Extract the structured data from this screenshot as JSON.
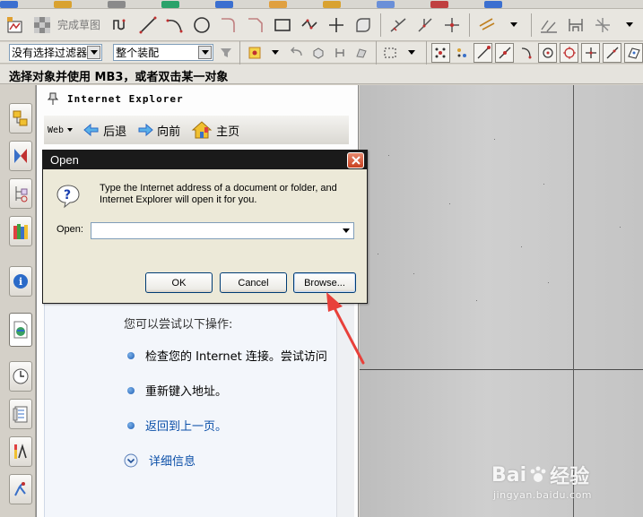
{
  "status_prompt": "选择对象并使用 MB3，或者双击某一对象",
  "toolbar1": {
    "sketch_label": "完成草图"
  },
  "toolbar2": {
    "filter_value": "没有选择过滤器",
    "assembly_value": "整个装配"
  },
  "ie_panel": {
    "title": "Internet Explorer",
    "web_label": "Web",
    "back_label": "后退",
    "forward_label": "向前",
    "home_label": "主页",
    "content": {
      "heading": "您可以尝试以下操作:",
      "items": [
        {
          "text": "检查您的 Internet 连接。尝试访问",
          "link": false
        },
        {
          "text": "重新键入地址。",
          "link": false
        },
        {
          "text": "返回到上一页。",
          "link": true
        }
      ],
      "more_info": "详细信息"
    }
  },
  "dialog": {
    "title": "Open",
    "message": "Type the Internet address of a document or folder, and Internet Explorer will open it for you.",
    "open_label": "Open:",
    "open_value": "",
    "ok_label": "OK",
    "cancel_label": "Cancel",
    "browse_label": "Browse..."
  },
  "watermark": {
    "main_a": "Bai",
    "main_b": "经验",
    "sub": "jingyan.baidu.com"
  },
  "colors": {
    "annotation_arrow": "#e8403a",
    "dialog_titlebar": "#1a1a1a",
    "link": "#0b4fa8"
  }
}
